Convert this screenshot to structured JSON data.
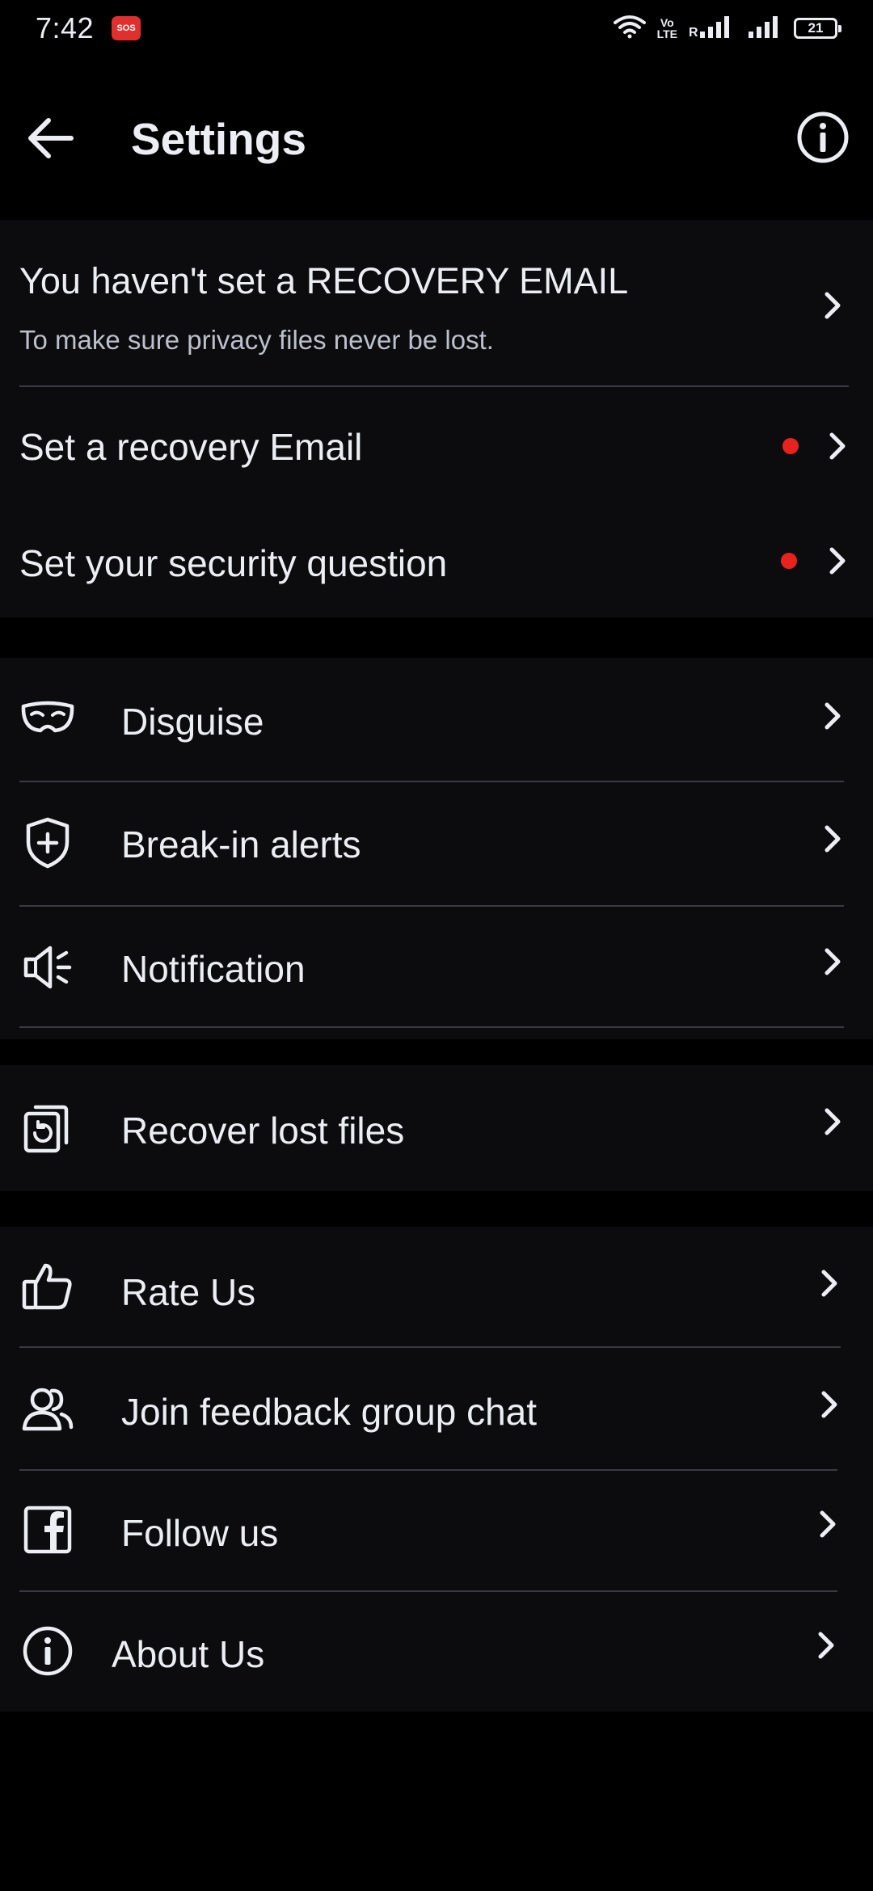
{
  "status_bar": {
    "time": "7:42",
    "sos_badge": "SOS",
    "volte_line1": "Vo",
    "volte_line2": "LTE",
    "battery_level": "21"
  },
  "header": {
    "title": "Settings",
    "back_icon": "arrow-left-icon",
    "info_icon": "info-circle-icon"
  },
  "recovery": {
    "banner_title": "You haven't set a RECOVERY EMAIL",
    "banner_subtitle": "To make sure privacy files never be lost.",
    "items": [
      {
        "label": "Set a recovery Email",
        "has_alert_dot": true
      },
      {
        "label": "Set your security question",
        "has_alert_dot": true
      }
    ]
  },
  "security": {
    "items": [
      {
        "label": "Disguise",
        "icon": "mask-icon"
      },
      {
        "label": "Break-in alerts",
        "icon": "shield-plus-icon"
      },
      {
        "label": "Notification",
        "icon": "speaker-icon"
      }
    ]
  },
  "recover_files": {
    "label": "Recover lost files",
    "icon": "recover-files-icon"
  },
  "social": {
    "items": [
      {
        "label": "Rate Us",
        "icon": "thumbs-up-icon"
      },
      {
        "label": "Join feedback group chat",
        "icon": "group-chat-icon"
      },
      {
        "label": "Follow us",
        "icon": "facebook-icon"
      },
      {
        "label": "About Us",
        "icon": "info-icon"
      }
    ]
  },
  "colors": {
    "background": "#000000",
    "card": "#0C0C0E",
    "text": "#ECEEF4",
    "subtext": "#BCC0CC",
    "divider": "#3A3B42",
    "alert_dot": "#E8231E",
    "sos": "#E0302E"
  }
}
